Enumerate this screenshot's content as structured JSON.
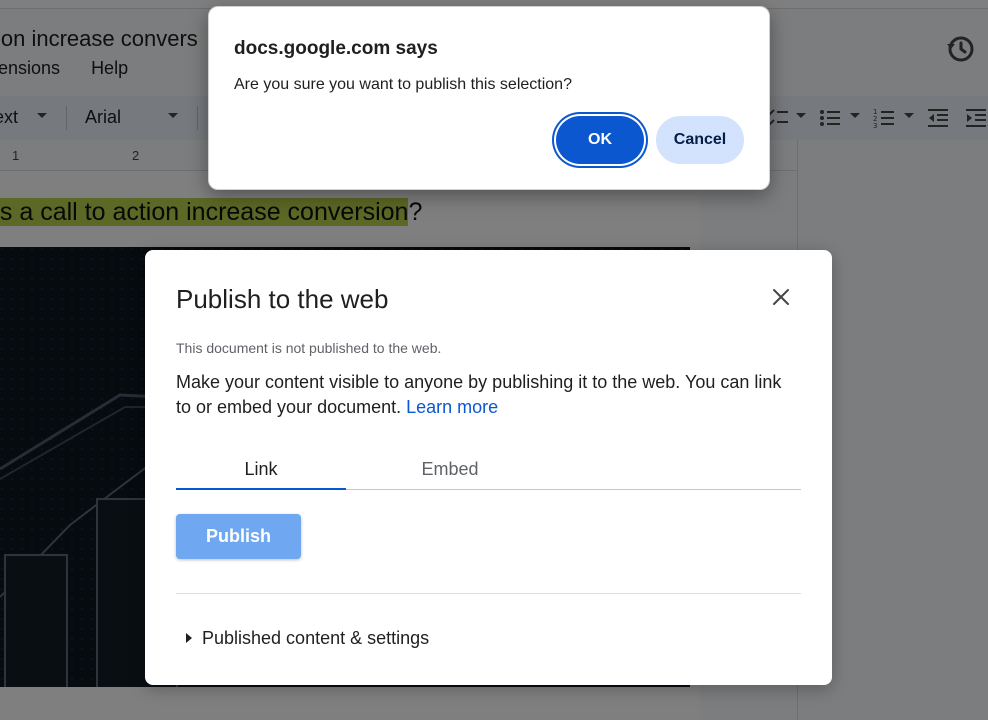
{
  "document": {
    "title": "ion increase convers",
    "menus": [
      "ensions",
      "Help"
    ],
    "heading_highlighted": "es a call to action increase conversion",
    "heading_rest": "?",
    "toolbar": {
      "style": "ext",
      "font": "Arial"
    },
    "ruler_numbers": [
      "1",
      "2"
    ]
  },
  "publish_dialog": {
    "title": "Publish to the web",
    "status": "This document is not published to the web.",
    "description": "Make your content visible to anyone by publishing it to the web. You can link to or embed your document.",
    "learn_more": "Learn more",
    "tabs": [
      "Link",
      "Embed"
    ],
    "active_tab": "Link",
    "publish_label": "Publish",
    "settings_label": "Published content & settings"
  },
  "alert": {
    "title": "docs.google.com says",
    "message": "Are you sure you want to publish this selection?",
    "ok_label": "OK",
    "cancel_label": "Cancel"
  },
  "icons": {
    "history": "history-icon",
    "close": "close-icon",
    "checklist": "checklist-icon",
    "bulleted_list": "bulleted-list-icon",
    "numbered_list": "numbered-list-icon",
    "decrease_indent": "decrease-indent-icon",
    "increase_indent": "increase-indent-icon"
  },
  "colors": {
    "accent": "#0b57d0",
    "publish_button": "#6fa8f0",
    "cancel_button": "#d3e3fd",
    "heading_highlight": "#b8d14a"
  }
}
